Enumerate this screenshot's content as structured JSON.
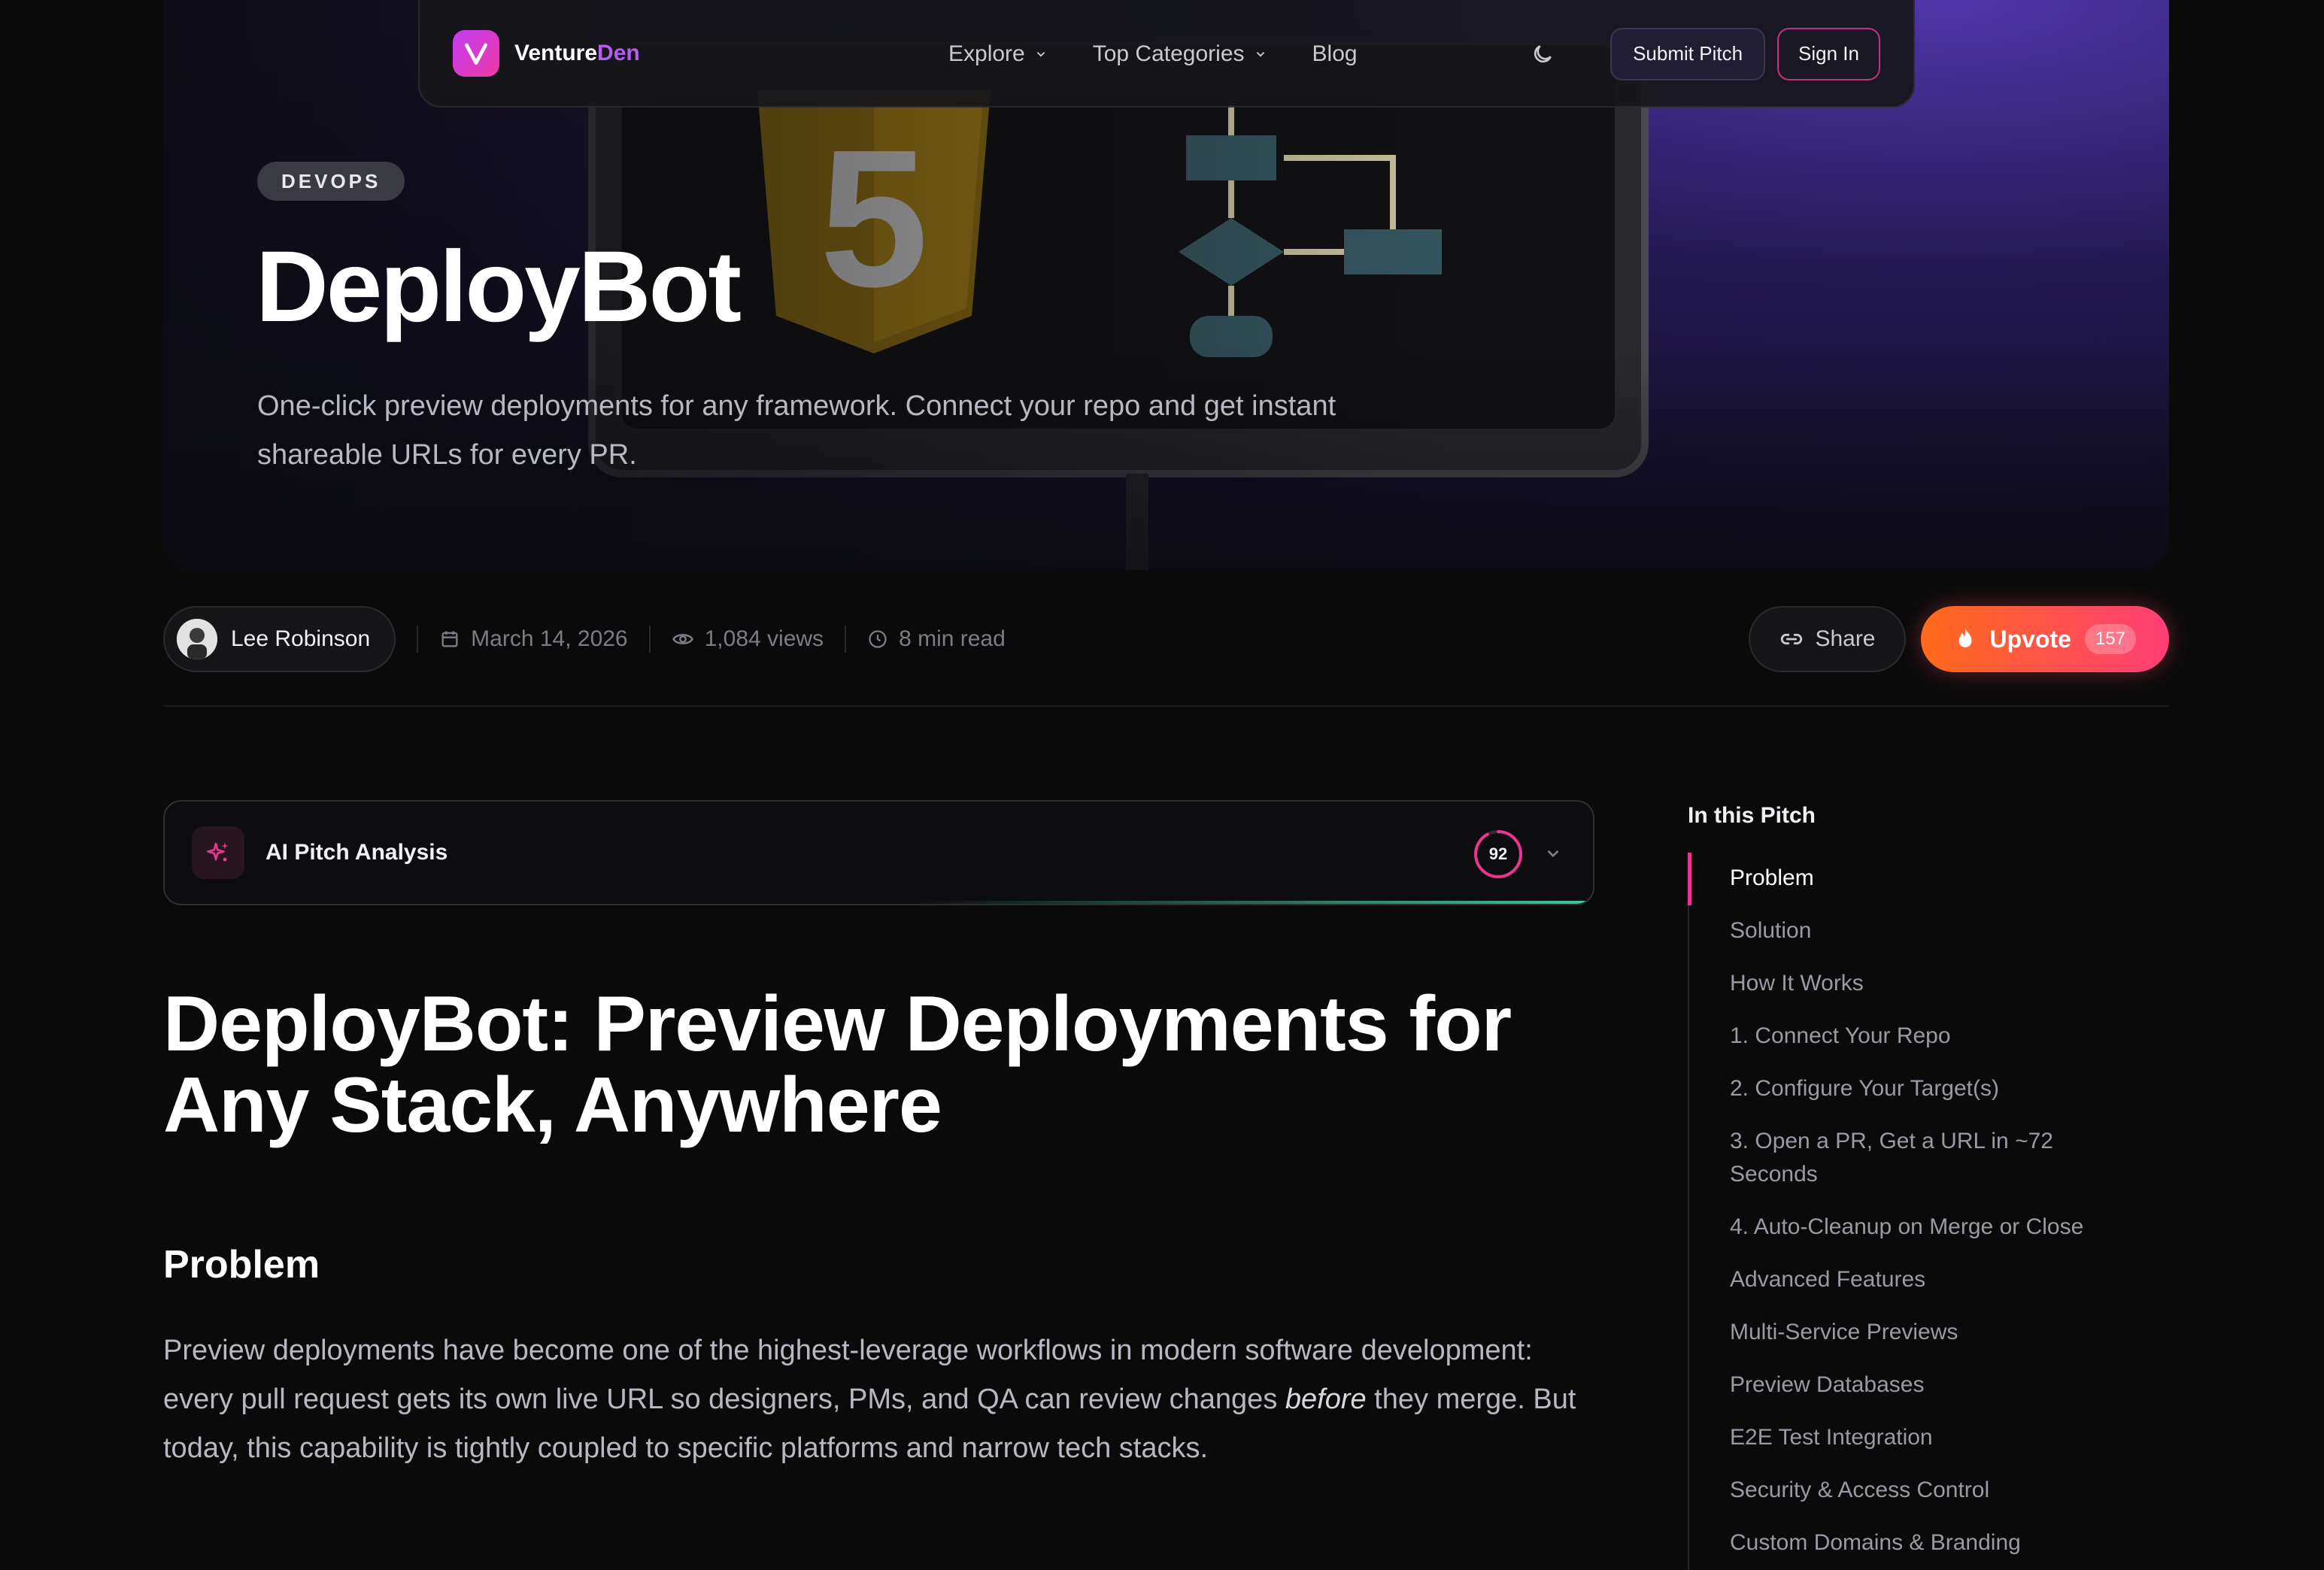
{
  "nav": {
    "brand_part1": "Venture",
    "brand_part2": "Den",
    "links": [
      {
        "label": "Explore"
      },
      {
        "label": "Top Categories"
      },
      {
        "label": "Blog"
      }
    ],
    "submit_label": "Submit Pitch",
    "signin_label": "Sign In"
  },
  "hero": {
    "tag": "DEVOPS",
    "title": "DeployBot",
    "description": "One-click preview deployments for any framework. Connect your repo and get instant shareable URLs for every PR."
  },
  "meta": {
    "author": "Lee Robinson",
    "date": "March 14, 2026",
    "views": "1,084 views",
    "read_time": "8 min read",
    "share_label": "Share",
    "upvote_label": "Upvote",
    "upvote_count": "157"
  },
  "ai": {
    "title": "AI Pitch Analysis",
    "score": "92",
    "score_fraction": 0.92
  },
  "article": {
    "title": "DeployBot: Preview Deployments for Any Stack, Anywhere",
    "section": "Problem",
    "para_part1": "Preview deployments have become one of the highest-leverage workflows in modern software development: every pull request gets its own live URL so designers, PMs, and QA can review changes ",
    "para_em": "before",
    "para_part2": " they merge. But today, this capability is tightly coupled to specific platforms and narrow tech stacks."
  },
  "toc": {
    "title": "In this Pitch",
    "items": [
      "Problem",
      "Solution",
      "How It Works",
      "1. Connect Your Repo",
      "2. Configure Your Target(s)",
      "3. Open a PR, Get a URL in ~72 Seconds",
      "4. Auto-Cleanup on Merge or Close",
      "Advanced Features",
      "Multi-Service Previews",
      "Preview Databases",
      "E2E Test Integration",
      "Security & Access Control",
      "Custom Domains & Branding"
    ]
  },
  "colors": {
    "accent_pink": "#e8368f",
    "upvote_start": "#ff6a1a",
    "upvote_end": "#ff3e77",
    "brand_purple": "#b45cf3"
  }
}
